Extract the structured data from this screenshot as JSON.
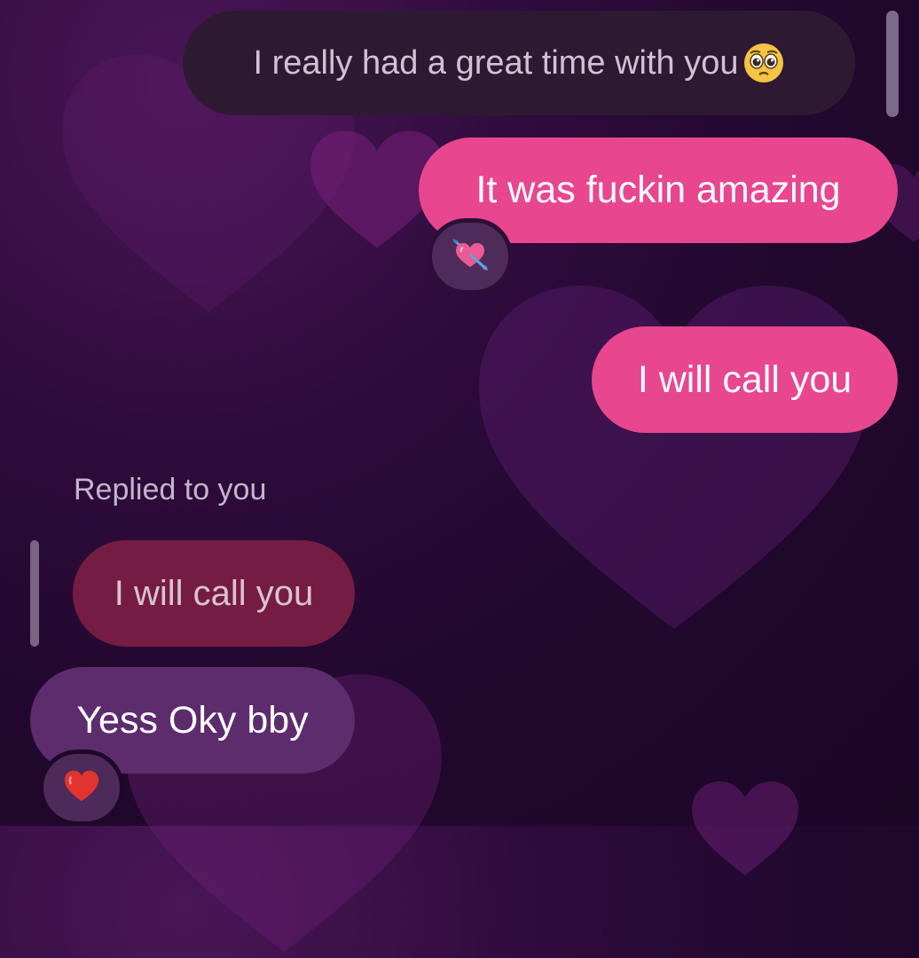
{
  "messages": [
    {
      "id": "quoted",
      "text": "I really had a great time with you",
      "emoji": "pleading-face-emoji"
    },
    {
      "id": "sent_1",
      "text": "It was fuckin amazing",
      "reaction": "heart-with-arrow-emoji"
    },
    {
      "id": "sent_2",
      "text": "I will call you"
    }
  ],
  "reply": {
    "label": "Replied to you",
    "quoted_text": "I will call you"
  },
  "received": {
    "text": "Yess Oky bby",
    "reaction": "red-heart-emoji"
  },
  "colors": {
    "sent_bubble": "#e8468f",
    "received_bubble": "#5c2c6c",
    "reply_ref_bubble": "#751c43",
    "quoted_bubble": "#2d1a32",
    "background": "#2e0b3c"
  }
}
